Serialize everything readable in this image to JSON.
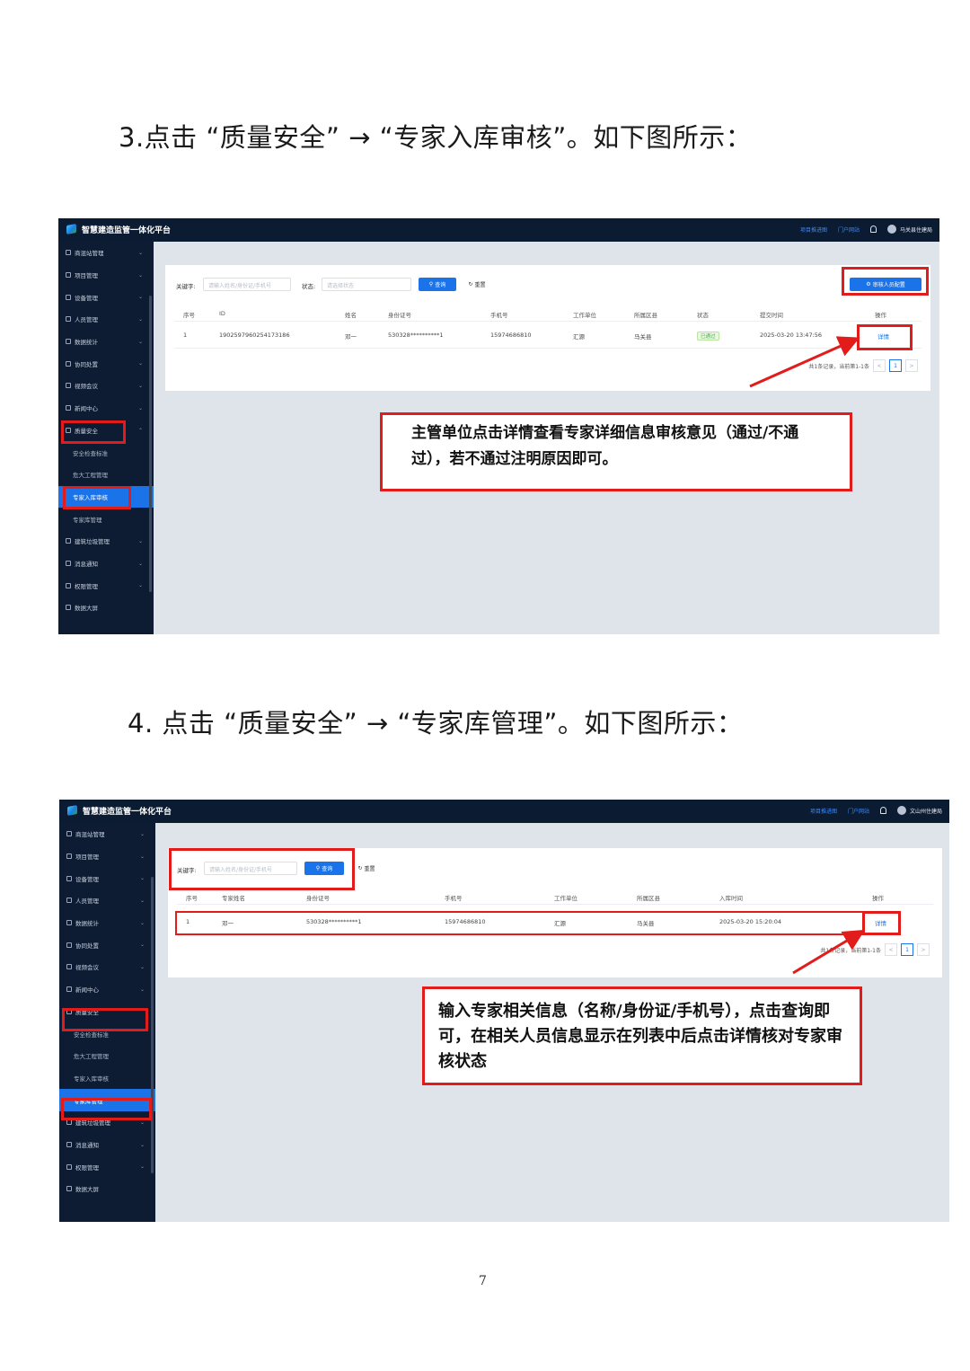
{
  "step3": {
    "heading": "3.点击 “质量安全” → “专家入库审核”。如下图所示：",
    "note": "主管单位点击详情查看专家详细信息审核意见（通过/不通过），若不通过注明原因即可。"
  },
  "step4": {
    "heading": "4. 点击 “质量安全” → “专家库管理”。如下图所示：",
    "note": "输入专家相关信息（名称/身份证/手机号），点击查询即可，在相关人员信息显示在列表中后点击详情核对专家审核状态"
  },
  "app": {
    "brand": "智慧建造监管一体化平台",
    "top_links": [
      "项目推进图",
      "门户网站"
    ],
    "sidebar": {
      "items": [
        "商混站管理",
        "项目管理",
        "设备管理",
        "人员管理",
        "数据统计",
        "协同处置",
        "视频会议",
        "新闻中心",
        "质量安全"
      ],
      "sub_items": [
        "安全检查标准",
        "危大工程管理",
        "专家入库审核",
        "专家库管理"
      ],
      "after": [
        "建筑垃圾管理",
        "消息通知",
        "权限管理",
        "数据大屏"
      ]
    }
  },
  "screen1": {
    "user": "马关县住建局",
    "filter": {
      "keyword_label": "关键字:",
      "keyword_placeholder": "请输入姓名/身份证/手机号",
      "status_label": "状态:",
      "status_placeholder": "请选择状态",
      "search": "查询",
      "reset": "重置",
      "config": "审核人员配置"
    },
    "columns": [
      "序号",
      "ID",
      "姓名",
      "身份证号",
      "手机号",
      "工作单位",
      "所属区县",
      "状态",
      "提交时间",
      "操作"
    ],
    "row": {
      "index": "1",
      "id": "1902597960254173186",
      "name": "邓一",
      "idcard": "530328**********1",
      "phone": "15974686810",
      "unit": "汇源",
      "county": "马关县",
      "status": "已通过",
      "time": "2025-03-20 13:47:56",
      "action": "详情"
    },
    "pager": {
      "summary": "共1条记录，当前第1-1条",
      "page": "1",
      "prev": "<",
      "next": ">"
    }
  },
  "screen2": {
    "user": "文山州住建局",
    "filter": {
      "keyword_label": "关键字:",
      "keyword_placeholder": "请输入姓名/身份证/手机号",
      "search": "查询",
      "reset": "重置"
    },
    "columns": [
      "序号",
      "专家姓名",
      "身份证号",
      "手机号",
      "工作单位",
      "所属区县",
      "入库时间",
      "操作"
    ],
    "row": {
      "index": "1",
      "name": "邓一",
      "idcard": "530328**********1",
      "phone": "15974686810",
      "unit": "汇源",
      "county": "马关县",
      "time": "2025-03-20 15:20:04",
      "action": "详情"
    },
    "pager": {
      "summary": "共1条记录，当前第1-1条",
      "page": "1",
      "prev": "<",
      "next": ">"
    }
  },
  "page_number": "7"
}
